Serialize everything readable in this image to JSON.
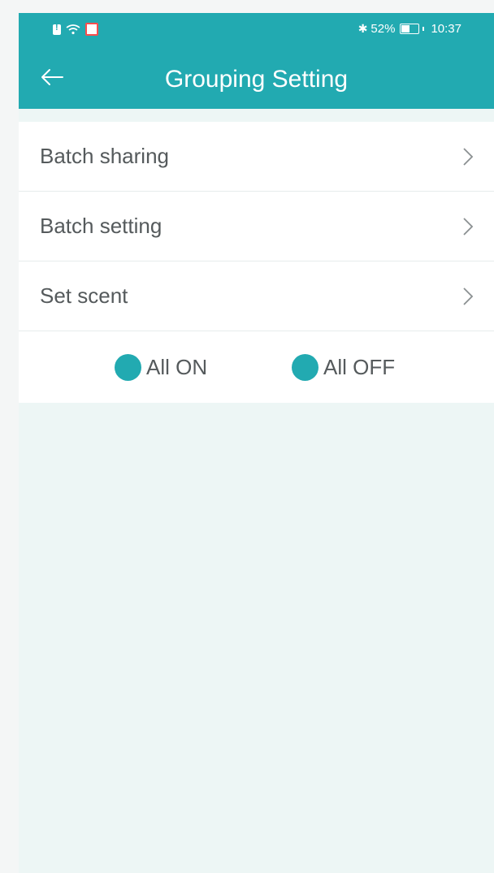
{
  "status_bar": {
    "battery_percent": "52%",
    "battery_level": 0.52,
    "time": "10:37",
    "icons": [
      "sim-alert-icon",
      "wifi-icon",
      "notification-icon",
      "bluetooth-icon",
      "battery-icon"
    ]
  },
  "header": {
    "title": "Grouping Setting",
    "back_icon": "arrow-left-icon"
  },
  "menu": {
    "items": [
      {
        "label": "Batch sharing",
        "icon": "chevron-right-icon"
      },
      {
        "label": "Batch setting",
        "icon": "chevron-right-icon"
      },
      {
        "label": "Set scent",
        "icon": "chevron-right-icon"
      }
    ]
  },
  "toggles": {
    "all_on": "All ON",
    "all_off": "All OFF"
  },
  "colors": {
    "accent": "#22aab1",
    "background": "#edf6f5",
    "text": "#555a5c"
  }
}
